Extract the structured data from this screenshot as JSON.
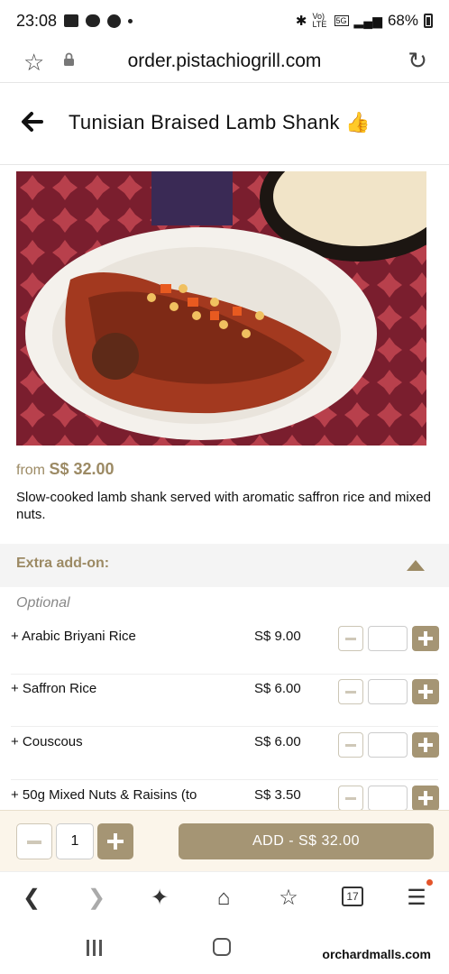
{
  "status_bar": {
    "time": "23:08",
    "network": "Vo) LTE",
    "network_gen": "5G",
    "battery": "68%"
  },
  "browser": {
    "url": "order.pistachiogrill.com",
    "tab_count": "17"
  },
  "page": {
    "title": "Tunisian Braised Lamb Shank 👍",
    "price_prefix": "from",
    "price": "S$ 32.00",
    "description": "Slow-cooked lamb shank served with aromatic saffron rice and mixed nuts."
  },
  "addons": {
    "section_title": "Extra add-on:",
    "optional_label": "Optional",
    "items": [
      {
        "name": "+ Arabic Briyani Rice",
        "price": "S$ 9.00"
      },
      {
        "name": "+ Saffron Rice",
        "price": "S$ 6.00"
      },
      {
        "name": "+ Couscous",
        "price": "S$ 6.00"
      },
      {
        "name": "+ 50g Mixed Nuts & Raisins (to",
        "price": "S$ 3.50"
      }
    ]
  },
  "order_bar": {
    "quantity": "1",
    "add_label": "ADD - S$ 32.00"
  },
  "watermark": "orchardmalls.com",
  "colors": {
    "accent": "#a59574",
    "accent_text": "#9c8a64"
  }
}
